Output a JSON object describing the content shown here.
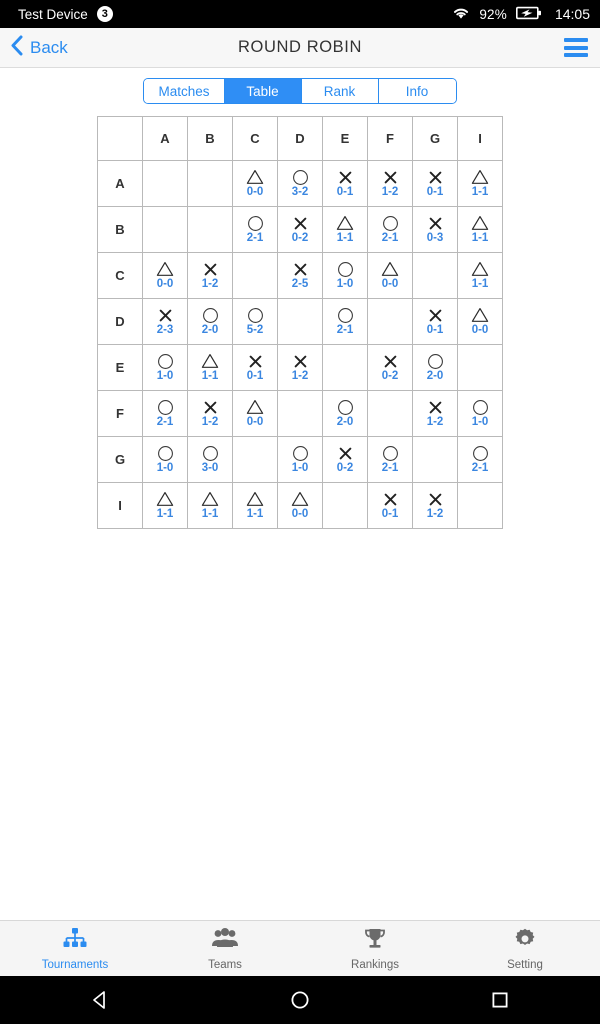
{
  "status_bar": {
    "device_name": "Test Device",
    "badge_count": "3",
    "wifi_icon": "wifi-icon",
    "battery_percent": "92%",
    "battery_icon": "battery-charging-icon",
    "time": "14:05"
  },
  "nav_bar": {
    "back_label": "Back",
    "back_icon": "chevron-left-icon",
    "title": "ROUND ROBIN",
    "menu_icon": "hamburger-menu-icon"
  },
  "tabs": {
    "items": [
      {
        "label": "Matches",
        "active": false
      },
      {
        "label": "Table",
        "active": true
      },
      {
        "label": "Rank",
        "active": false
      },
      {
        "label": "Info",
        "active": false
      }
    ]
  },
  "colors": {
    "accent": "#2b8cf0",
    "accent_fill": "#2f8ef5",
    "score_text": "#3a86e0",
    "diagonal_cell": "#cccccc",
    "grid_line": "#b9b9b9"
  },
  "table": {
    "corner_label": "",
    "column_headers": [
      "A",
      "B",
      "C",
      "D",
      "E",
      "F",
      "G",
      "I"
    ],
    "row_headers": [
      "A",
      "B",
      "C",
      "D",
      "E",
      "F",
      "G",
      "I"
    ],
    "legend": {
      "circle": "win",
      "cross": "loss",
      "triangle": "draw"
    },
    "rows": [
      {
        "header": "A",
        "cells": [
          {
            "type": "diagonal"
          },
          {
            "type": "blank"
          },
          {
            "type": "result",
            "symbol": "triangle",
            "score": "0-0"
          },
          {
            "type": "result",
            "symbol": "circle",
            "score": "3-2"
          },
          {
            "type": "result",
            "symbol": "cross",
            "score": "0-1"
          },
          {
            "type": "result",
            "symbol": "cross",
            "score": "1-2"
          },
          {
            "type": "result",
            "symbol": "cross",
            "score": "0-1"
          },
          {
            "type": "result",
            "symbol": "triangle",
            "score": "1-1"
          }
        ]
      },
      {
        "header": "B",
        "cells": [
          {
            "type": "blank"
          },
          {
            "type": "diagonal"
          },
          {
            "type": "result",
            "symbol": "circle",
            "score": "2-1"
          },
          {
            "type": "result",
            "symbol": "cross",
            "score": "0-2"
          },
          {
            "type": "result",
            "symbol": "triangle",
            "score": "1-1"
          },
          {
            "type": "result",
            "symbol": "circle",
            "score": "2-1"
          },
          {
            "type": "result",
            "symbol": "cross",
            "score": "0-3"
          },
          {
            "type": "result",
            "symbol": "triangle",
            "score": "1-1"
          }
        ]
      },
      {
        "header": "C",
        "cells": [
          {
            "type": "result",
            "symbol": "triangle",
            "score": "0-0"
          },
          {
            "type": "result",
            "symbol": "cross",
            "score": "1-2"
          },
          {
            "type": "diagonal"
          },
          {
            "type": "result",
            "symbol": "cross",
            "score": "2-5"
          },
          {
            "type": "result",
            "symbol": "circle",
            "score": "1-0"
          },
          {
            "type": "result",
            "symbol": "triangle",
            "score": "0-0"
          },
          {
            "type": "blank"
          },
          {
            "type": "result",
            "symbol": "triangle",
            "score": "1-1"
          }
        ]
      },
      {
        "header": "D",
        "cells": [
          {
            "type": "result",
            "symbol": "cross",
            "score": "2-3"
          },
          {
            "type": "result",
            "symbol": "circle",
            "score": "2-0"
          },
          {
            "type": "result",
            "symbol": "circle",
            "score": "5-2"
          },
          {
            "type": "diagonal"
          },
          {
            "type": "result",
            "symbol": "circle",
            "score": "2-1"
          },
          {
            "type": "blank"
          },
          {
            "type": "result",
            "symbol": "cross",
            "score": "0-1"
          },
          {
            "type": "result",
            "symbol": "triangle",
            "score": "0-0"
          }
        ]
      },
      {
        "header": "E",
        "cells": [
          {
            "type": "result",
            "symbol": "circle",
            "score": "1-0"
          },
          {
            "type": "result",
            "symbol": "triangle",
            "score": "1-1"
          },
          {
            "type": "result",
            "symbol": "cross",
            "score": "0-1"
          },
          {
            "type": "result",
            "symbol": "cross",
            "score": "1-2"
          },
          {
            "type": "diagonal"
          },
          {
            "type": "result",
            "symbol": "cross",
            "score": "0-2"
          },
          {
            "type": "result",
            "symbol": "circle",
            "score": "2-0"
          },
          {
            "type": "blank"
          }
        ]
      },
      {
        "header": "F",
        "cells": [
          {
            "type": "result",
            "symbol": "circle",
            "score": "2-1"
          },
          {
            "type": "result",
            "symbol": "cross",
            "score": "1-2"
          },
          {
            "type": "result",
            "symbol": "triangle",
            "score": "0-0"
          },
          {
            "type": "blank"
          },
          {
            "type": "result",
            "symbol": "circle",
            "score": "2-0"
          },
          {
            "type": "diagonal"
          },
          {
            "type": "result",
            "symbol": "cross",
            "score": "1-2"
          },
          {
            "type": "result",
            "symbol": "circle",
            "score": "1-0"
          }
        ]
      },
      {
        "header": "G",
        "cells": [
          {
            "type": "result",
            "symbol": "circle",
            "score": "1-0"
          },
          {
            "type": "result",
            "symbol": "circle",
            "score": "3-0"
          },
          {
            "type": "blank"
          },
          {
            "type": "result",
            "symbol": "circle",
            "score": "1-0"
          },
          {
            "type": "result",
            "symbol": "cross",
            "score": "0-2"
          },
          {
            "type": "result",
            "symbol": "circle",
            "score": "2-1"
          },
          {
            "type": "diagonal"
          },
          {
            "type": "result",
            "symbol": "circle",
            "score": "2-1"
          }
        ]
      },
      {
        "header": "I",
        "cells": [
          {
            "type": "result",
            "symbol": "triangle",
            "score": "1-1"
          },
          {
            "type": "result",
            "symbol": "triangle",
            "score": "1-1"
          },
          {
            "type": "result",
            "symbol": "triangle",
            "score": "1-1"
          },
          {
            "type": "result",
            "symbol": "triangle",
            "score": "0-0"
          },
          {
            "type": "blank"
          },
          {
            "type": "result",
            "symbol": "cross",
            "score": "0-1"
          },
          {
            "type": "result",
            "symbol": "cross",
            "score": "1-2"
          },
          {
            "type": "diagonal"
          }
        ]
      }
    ]
  },
  "bottom_nav": {
    "items": [
      {
        "label": "Tournaments",
        "icon": "tournament-bracket-icon",
        "active": true
      },
      {
        "label": "Teams",
        "icon": "people-group-icon",
        "active": false
      },
      {
        "label": "Rankings",
        "icon": "trophy-icon",
        "active": false
      },
      {
        "label": "Setting",
        "icon": "gear-icon",
        "active": false
      }
    ]
  },
  "system_nav": {
    "back": "back-triangle-icon",
    "home": "home-circle-icon",
    "recents": "recents-square-icon"
  }
}
